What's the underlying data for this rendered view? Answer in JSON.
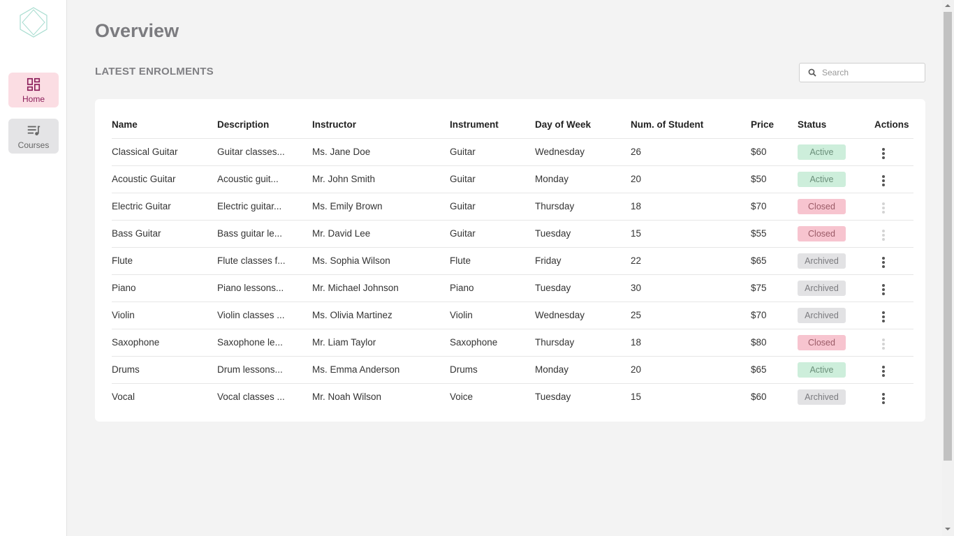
{
  "sidebar": {
    "logo": "hexagon-logo",
    "items": [
      {
        "label": "Home",
        "icon": "dashboard-icon",
        "active": true
      },
      {
        "label": "Courses",
        "icon": "playlist-icon",
        "active": false
      }
    ]
  },
  "page": {
    "title": "Overview",
    "section_title": "LATEST ENROLMENTS"
  },
  "search": {
    "placeholder": "Search",
    "value": "",
    "icon": "search-icon"
  },
  "table": {
    "columns": [
      "Name",
      "Description",
      "Instructor",
      "Instrument",
      "Day of Week",
      "Num. of Student",
      "Price",
      "Status",
      "Actions"
    ],
    "rows": [
      {
        "name": "Classical Guitar",
        "description": "Guitar classes...",
        "instructor": "Ms. Jane Doe",
        "instrument": "Guitar",
        "day": "Wednesday",
        "students": "26",
        "price": "$60",
        "status": "Active",
        "actions_enabled": true
      },
      {
        "name": "Acoustic Guitar",
        "description": "Acoustic guit...",
        "instructor": "Mr. John Smith",
        "instrument": "Guitar",
        "day": "Monday",
        "students": "20",
        "price": "$50",
        "status": "Active",
        "actions_enabled": true
      },
      {
        "name": "Electric Guitar",
        "description": "Electric guitar...",
        "instructor": "Ms. Emily Brown",
        "instrument": "Guitar",
        "day": "Thursday",
        "students": "18",
        "price": "$70",
        "status": "Closed",
        "actions_enabled": false
      },
      {
        "name": "Bass Guitar",
        "description": "Bass guitar le...",
        "instructor": "Mr. David Lee",
        "instrument": "Guitar",
        "day": "Tuesday",
        "students": "15",
        "price": "$55",
        "status": "Closed",
        "actions_enabled": false
      },
      {
        "name": "Flute",
        "description": "Flute classes f...",
        "instructor": "Ms. Sophia Wilson",
        "instrument": "Flute",
        "day": "Friday",
        "students": "22",
        "price": "$65",
        "status": "Archived",
        "actions_enabled": true
      },
      {
        "name": "Piano",
        "description": "Piano lessons...",
        "instructor": "Mr. Michael Johnson",
        "instrument": "Piano",
        "day": "Tuesday",
        "students": "30",
        "price": "$75",
        "status": "Archived",
        "actions_enabled": true
      },
      {
        "name": "Violin",
        "description": "Violin classes ...",
        "instructor": "Ms. Olivia Martinez",
        "instrument": "Violin",
        "day": "Wednesday",
        "students": "25",
        "price": "$70",
        "status": "Archived",
        "actions_enabled": true
      },
      {
        "name": "Saxophone",
        "description": "Saxophone le...",
        "instructor": "Mr. Liam Taylor",
        "instrument": "Saxophone",
        "day": "Thursday",
        "students": "18",
        "price": "$80",
        "status": "Closed",
        "actions_enabled": false
      },
      {
        "name": "Drums",
        "description": "Drum lessons...",
        "instructor": "Ms. Emma Anderson",
        "instrument": "Drums",
        "day": "Monday",
        "students": "20",
        "price": "$65",
        "status": "Active",
        "actions_enabled": true
      },
      {
        "name": "Vocal",
        "description": "Vocal classes ...",
        "instructor": "Mr. Noah Wilson",
        "instrument": "Voice",
        "day": "Tuesday",
        "students": "15",
        "price": "$60",
        "status": "Archived",
        "actions_enabled": true
      }
    ]
  },
  "colors": {
    "accent": "#8b1e5a",
    "active_nav_bg": "#fbdde3",
    "status_active_bg": "#cdeedb",
    "status_closed_bg": "#f7c4cf",
    "status_archived_bg": "#e2e2e4"
  }
}
